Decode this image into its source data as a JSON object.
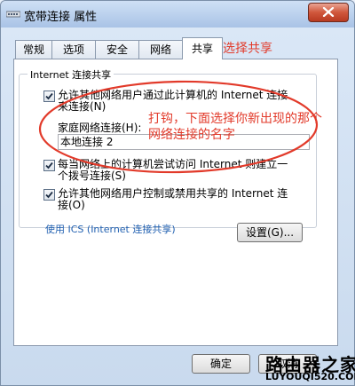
{
  "window": {
    "title": "宽带连接 属性"
  },
  "tabs": [
    {
      "label": "常规"
    },
    {
      "label": "选项"
    },
    {
      "label": "安全"
    },
    {
      "label": "网络"
    },
    {
      "label": "共享"
    }
  ],
  "group": {
    "title": "Internet 连接共享",
    "allow_share_line1": "允许其他网络用户通过此计算机的 Internet 连接",
    "allow_share_line2": "来连接(N)",
    "home_network_label": "家庭网络连接(H):",
    "home_network_value": "本地连接 2",
    "dial_line1": "每当网络上的计算机尝试访问 Internet 则建立一",
    "dial_line2": "个拨号连接(S)",
    "control_line1": "允许其他网络用户控制或禁用共享的 Internet 连",
    "control_line2": "接(O)"
  },
  "link": {
    "label": "使用 ICS (Internet 连接共享)"
  },
  "buttons": {
    "settings": "设置(G)...",
    "ok": "确定",
    "cancel": "取消"
  },
  "annotations": {
    "select_share": "选择共享",
    "instruction_line1": "打钩，下面选择你新出现的那个",
    "instruction_line2": "网络连接的名字",
    "color": "#e23a2a"
  },
  "watermark": {
    "site_name": "路由器之家",
    "site_url": "LUYOUQI520.COM"
  }
}
